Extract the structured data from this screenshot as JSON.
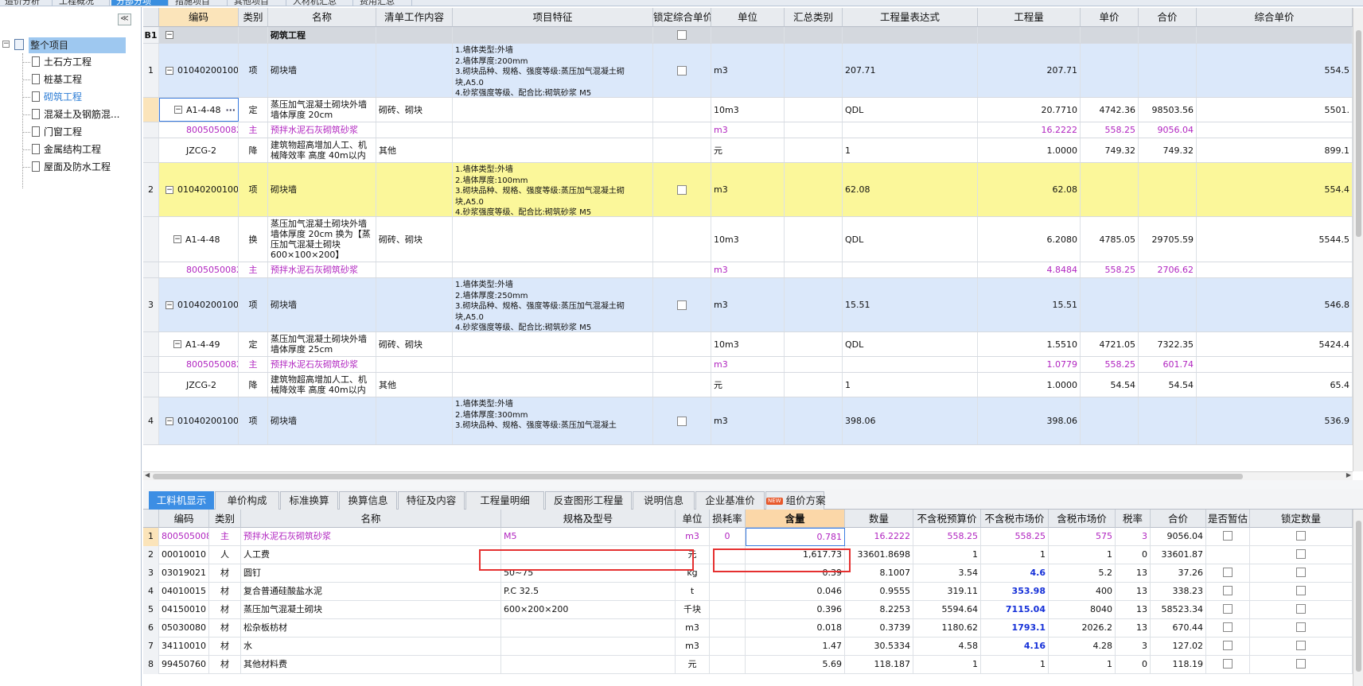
{
  "top_tabs": [
    {
      "label": "造价分析",
      "active": false
    },
    {
      "label": "工程概况",
      "active": false
    },
    {
      "label": "分部分项",
      "active": true
    },
    {
      "label": "措施项目",
      "active": false
    },
    {
      "label": "其他项目",
      "active": false
    },
    {
      "label": "人材机汇总",
      "active": false
    },
    {
      "label": "费用汇总",
      "active": false
    }
  ],
  "tree": {
    "collapse_label": "≪",
    "root_toggle": "−",
    "root": "整个项目",
    "items": [
      "土石方工程",
      "桩基工程",
      "砌筑工程",
      "混凝土及钢筋混...",
      "门窗工程",
      "金属结构工程",
      "屋面及防水工程"
    ]
  },
  "main_grid": {
    "headers": [
      "",
      "编码",
      "类别",
      "名称",
      "清单工作内容",
      "项目特征",
      "锁定综合单价",
      "单位",
      "汇总类别",
      "工程量表达式",
      "工程量",
      "单价",
      "合价",
      "综合单价"
    ],
    "rows": [
      {
        "rownum": "B1",
        "code": "",
        "type": "",
        "name": "砌筑工程",
        "work": "",
        "feature": "",
        "lock": true,
        "unit": "",
        "sumcat": "",
        "expr": "",
        "qty": "",
        "price": "",
        "total": "",
        "unitprice": ""
      },
      {
        "rownum": "1",
        "code": "010402001001",
        "type": "项",
        "name": "砌块墙",
        "work": "",
        "feature": "1.墙体类型:外墙\n2.墙体厚度:200mm\n3.砌块品种、规格、强度等级:蒸压加气混凝土砌块,A5.0\n4.砂浆强度等级、配合比:砌筑砂浆 M5",
        "lock": true,
        "unit": "m3",
        "sumcat": "",
        "expr": "207.71",
        "qty": "207.71",
        "price": "",
        "total": "",
        "unitprice": "554.5"
      },
      {
        "rownum": "",
        "code": "A1-4-48",
        "type": "定",
        "name": "蒸压加气混凝土砌块外墙 墙体厚度 20cm",
        "work": "砌砖、砌块",
        "feature": "",
        "lock": false,
        "unit": "10m3",
        "sumcat": "",
        "expr": "QDL",
        "qty": "20.7710",
        "price": "4742.36",
        "total": "98503.56",
        "unitprice": "5501."
      },
      {
        "rownum": "",
        "code": "8005050082",
        "type": "主",
        "name": "预拌水泥石灰砌筑砂浆",
        "work": "",
        "feature": "",
        "lock": false,
        "unit": "m3",
        "sumcat": "",
        "expr": "",
        "qty": "16.2222",
        "price": "558.25",
        "total": "9056.04",
        "unitprice": ""
      },
      {
        "rownum": "",
        "code": "JZCG-2",
        "type": "降",
        "name": "建筑物超高增加人工、机械降效率 高度 40m以内",
        "work": "其他",
        "feature": "",
        "lock": false,
        "unit": "元",
        "sumcat": "",
        "expr": "1",
        "qty": "1.0000",
        "price": "749.32",
        "total": "749.32",
        "unitprice": "899.1"
      },
      {
        "rownum": "2",
        "code": "010402001008",
        "type": "项",
        "name": "砌块墙",
        "work": "",
        "feature": "1.墙体类型:外墙\n2.墙体厚度:100mm\n3.砌块品种、规格、强度等级:蒸压加气混凝土砌块,A5.0\n4.砂浆强度等级、配合比:砌筑砂浆 M5",
        "lock": true,
        "unit": "m3",
        "sumcat": "",
        "expr": "62.08",
        "qty": "62.08",
        "price": "",
        "total": "",
        "unitprice": "554.4"
      },
      {
        "rownum": "",
        "code": "A1-4-48",
        "type": "换",
        "name": "蒸压加气混凝土砌块外墙 墙体厚度 20cm 换为【蒸压加气混凝土砌块 600×100×200】",
        "work": "砌砖、砌块",
        "feature": "",
        "lock": false,
        "unit": "10m3",
        "sumcat": "",
        "expr": "QDL",
        "qty": "6.2080",
        "price": "4785.05",
        "total": "29705.59",
        "unitprice": "5544.5"
      },
      {
        "rownum": "",
        "code": "8005050082",
        "type": "主",
        "name": "预拌水泥石灰砌筑砂浆",
        "work": "",
        "feature": "",
        "lock": false,
        "unit": "m3",
        "sumcat": "",
        "expr": "",
        "qty": "4.8484",
        "price": "558.25",
        "total": "2706.62",
        "unitprice": ""
      },
      {
        "rownum": "3",
        "code": "010402001002",
        "type": "项",
        "name": "砌块墙",
        "work": "",
        "feature": "1.墙体类型:外墙\n2.墙体厚度:250mm\n3.砌块品种、规格、强度等级:蒸压加气混凝土砌块,A5.0\n4.砂浆强度等级、配合比:砌筑砂浆 M5",
        "lock": true,
        "unit": "m3",
        "sumcat": "",
        "expr": "15.51",
        "qty": "15.51",
        "price": "",
        "total": "",
        "unitprice": "546.8"
      },
      {
        "rownum": "",
        "code": "A1-4-49",
        "type": "定",
        "name": "蒸压加气混凝土砌块外墙 墙体厚度 25cm",
        "work": "砌砖、砌块",
        "feature": "",
        "lock": false,
        "unit": "10m3",
        "sumcat": "",
        "expr": "QDL",
        "qty": "1.5510",
        "price": "4721.05",
        "total": "7322.35",
        "unitprice": "5424.4"
      },
      {
        "rownum": "",
        "code": "8005050082",
        "type": "主",
        "name": "预拌水泥石灰砌筑砂浆",
        "work": "",
        "feature": "",
        "lock": false,
        "unit": "m3",
        "sumcat": "",
        "expr": "",
        "qty": "1.0779",
        "price": "558.25",
        "total": "601.74",
        "unitprice": ""
      },
      {
        "rownum": "",
        "code": "JZCG-2",
        "type": "降",
        "name": "建筑物超高增加人工、机械降效率 高度 40m以内",
        "work": "其他",
        "feature": "",
        "lock": false,
        "unit": "元",
        "sumcat": "",
        "expr": "1",
        "qty": "1.0000",
        "price": "54.54",
        "total": "54.54",
        "unitprice": "65.4"
      },
      {
        "rownum": "4",
        "code": "010402001003",
        "type": "项",
        "name": "砌块墙",
        "work": "",
        "feature": "1.墙体类型:外墙\n2.墙体厚度:300mm\n3.砌块品种、规格、强度等级:蒸压加气混凝土",
        "lock": true,
        "unit": "m3",
        "sumcat": "",
        "expr": "398.06",
        "qty": "398.06",
        "price": "",
        "total": "",
        "unitprice": "536.9"
      }
    ]
  },
  "bottom_tabs": [
    "工料机显示",
    "单价构成",
    "标准换算",
    "换算信息",
    "特征及内容",
    "工程量明细",
    "反查图形工程量",
    "说明信息",
    "企业基准价",
    "组价方案"
  ],
  "new_badge": "NEW",
  "detail_grid": {
    "headers": [
      "",
      "编码",
      "类别",
      "名称",
      "规格及型号",
      "单位",
      "损耗率",
      "含量",
      "数量",
      "不含税预算价",
      "不含税市场价",
      "含税市场价",
      "税率",
      "合价",
      "是否暂估",
      "锁定数量"
    ],
    "rows": [
      {
        "n": "1",
        "code": "8005050082",
        "type": "主",
        "name": "预拌水泥石灰砌筑砂浆",
        "spec": "M5",
        "unit": "m3",
        "loss": "0",
        "content": "0.781",
        "qty": "16.2222",
        "pre": "558.25",
        "mkt": "558.25",
        "mkttax": "575",
        "tax": "3",
        "total": "9056.04",
        "est": true,
        "lockq": true
      },
      {
        "n": "2",
        "code": "00010010",
        "type": "人",
        "name": "人工费",
        "spec": "",
        "unit": "元",
        "loss": "",
        "content": "1,617.73",
        "qty": "33601.8698",
        "pre": "1",
        "mkt": "1",
        "mkttax": "1",
        "tax": "0",
        "total": "33601.87",
        "est": false,
        "lockq": true
      },
      {
        "n": "3",
        "code": "03019021",
        "type": "材",
        "name": "圆钉",
        "spec": "50~75",
        "unit": "kg",
        "loss": "",
        "content": "0.39",
        "qty": "8.1007",
        "pre": "3.54",
        "mkt": "4.6",
        "mkttax": "5.2",
        "tax": "13",
        "total": "37.26",
        "est": true,
        "lockq": true
      },
      {
        "n": "4",
        "code": "04010015",
        "type": "材",
        "name": "复合普通硅酸盐水泥",
        "spec": "P.C 32.5",
        "unit": "t",
        "loss": "",
        "content": "0.046",
        "qty": "0.9555",
        "pre": "319.11",
        "mkt": "353.98",
        "mkttax": "400",
        "tax": "13",
        "total": "338.23",
        "est": true,
        "lockq": true
      },
      {
        "n": "5",
        "code": "04150010",
        "type": "材",
        "name": "蒸压加气混凝土砌块",
        "spec": "600×200×200",
        "unit": "千块",
        "loss": "",
        "content": "0.396",
        "qty": "8.2253",
        "pre": "5594.64",
        "mkt": "7115.04",
        "mkttax": "8040",
        "tax": "13",
        "total": "58523.34",
        "est": true,
        "lockq": true
      },
      {
        "n": "6",
        "code": "05030080",
        "type": "材",
        "name": "松杂板枋材",
        "spec": "",
        "unit": "m3",
        "loss": "",
        "content": "0.018",
        "qty": "0.3739",
        "pre": "1180.62",
        "mkt": "1793.1",
        "mkttax": "2026.2",
        "tax": "13",
        "total": "670.44",
        "est": true,
        "lockq": true
      },
      {
        "n": "7",
        "code": "34110010",
        "type": "材",
        "name": "水",
        "spec": "",
        "unit": "m3",
        "loss": "",
        "content": "1.47",
        "qty": "30.5334",
        "pre": "4.58",
        "mkt": "4.16",
        "mkttax": "4.28",
        "tax": "3",
        "total": "127.02",
        "est": true,
        "lockq": true
      },
      {
        "n": "8",
        "code": "99450760",
        "type": "材",
        "name": "其他材料费",
        "spec": "",
        "unit": "元",
        "loss": "",
        "content": "5.69",
        "qty": "118.187",
        "pre": "1",
        "mkt": "1",
        "mkttax": "1",
        "tax": "0",
        "total": "118.19",
        "est": true,
        "lockq": true
      }
    ]
  },
  "colors": {
    "accent": "#3c8ee4",
    "highlight_yellow": "#fbf79a",
    "highlight_blue": "#dbe8fa",
    "purple_text": "#b125c0",
    "blue_value": "#1530d8",
    "annotation_red": "#e53030"
  }
}
